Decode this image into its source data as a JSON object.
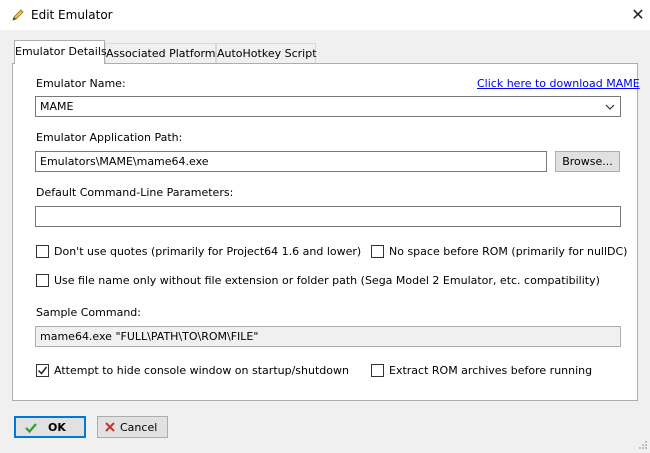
{
  "window": {
    "title": "Edit Emulator",
    "close_glyph": "✕",
    "icon": "pencil-icon"
  },
  "tabs": [
    {
      "label": "Emulator Details",
      "active": true
    },
    {
      "label": "Associated Platforms",
      "active": false
    },
    {
      "label": "AutoHotkey Script",
      "active": false
    }
  ],
  "form": {
    "name_label": "Emulator Name:",
    "download_link": "Click here to download MAME",
    "name_value": "MAME",
    "app_path_label": "Emulator Application Path:",
    "app_path_value": "Emulators\\MAME\\mame64.exe",
    "browse_label": "Browse...",
    "params_label": "Default Command-Line Parameters:",
    "params_value": "",
    "dont_use_quotes": {
      "label": "Don't use quotes (primarily for Project64 1.6 and lower)",
      "checked": false
    },
    "no_space_before_rom": {
      "label": "No space before ROM (primarily for nullDC)",
      "checked": false
    },
    "file_name_only": {
      "label": "Use file name only without file extension or folder path (Sega Model 2 Emulator, etc. compatibility)",
      "checked": false
    },
    "sample_label": "Sample Command:",
    "sample_value": "mame64.exe \"FULL\\PATH\\TO\\ROM\\FILE\"",
    "hide_console": {
      "label": "Attempt to hide console window on startup/shutdown",
      "checked": true
    },
    "extract_rom": {
      "label": "Extract ROM archives before running",
      "checked": false
    }
  },
  "footer": {
    "ok_label": "OK",
    "cancel_label": "Cancel"
  },
  "colors": {
    "accent": "#0078d7",
    "check_green": "#2e9e2e",
    "cancel_red": "#c0392b",
    "link": "#0000ee"
  }
}
